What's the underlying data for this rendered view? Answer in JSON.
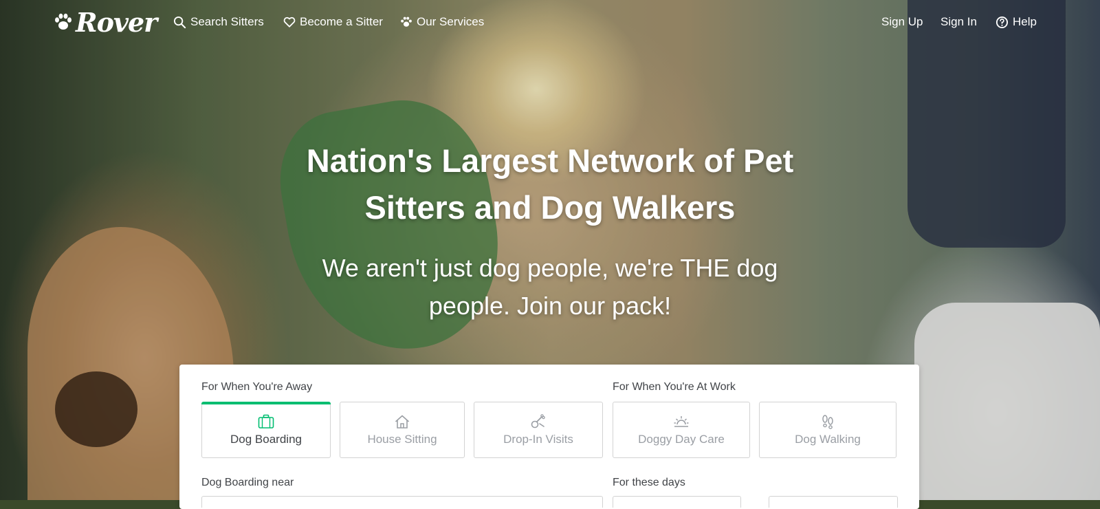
{
  "brand": {
    "logo_text": "Rover"
  },
  "nav": {
    "search_sitters": "Search Sitters",
    "become_sitter": "Become a Sitter",
    "our_services": "Our Services",
    "sign_up": "Sign Up",
    "sign_in": "Sign In",
    "help": "Help"
  },
  "hero": {
    "headline_line1": "Nation's Largest Network of Pet",
    "headline_line2": "Sitters and Dog Walkers",
    "sub_line1": "We aren't just dog people, we're THE dog",
    "sub_line2": "people. Join our pack!"
  },
  "search": {
    "away_label": "For When You're Away",
    "work_label": "For When You're At Work",
    "services": [
      {
        "label": "Dog Boarding",
        "icon": "suitcase-icon",
        "selected": true
      },
      {
        "label": "House Sitting",
        "icon": "house-icon",
        "selected": false
      },
      {
        "label": "Drop-In Visits",
        "icon": "ball-and-bone-icon",
        "selected": false
      },
      {
        "label": "Doggy Day Care",
        "icon": "sun-icon",
        "selected": false
      },
      {
        "label": "Dog Walking",
        "icon": "footprints-icon",
        "selected": false
      }
    ],
    "near_label": "Dog Boarding near",
    "days_label": "For these days"
  },
  "colors": {
    "accent_green": "#00bd70",
    "text_dark": "#404347",
    "text_muted": "#9a9ea4",
    "border": "#d2d2d2"
  }
}
